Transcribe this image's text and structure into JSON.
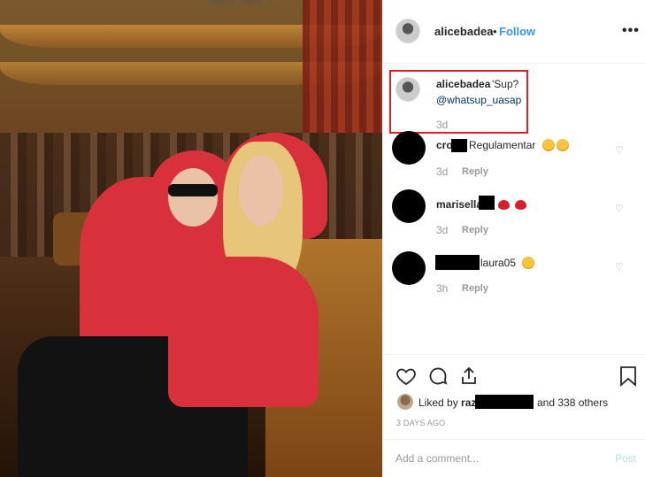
{
  "browser": {
    "url_fragment": "https://...com/.../"
  },
  "header": {
    "username": "alicebadea",
    "separator": "•",
    "follow_label": "Follow",
    "more_label": "•••",
    "avatar_icon": "profile-avatar-icon"
  },
  "caption": {
    "username": "alicebadea",
    "text": "'Sup?",
    "mention": "@whatsup_uasap",
    "time": "3d"
  },
  "comments": [
    {
      "username": "cro",
      "text": "Regulamentar",
      "time": "3d",
      "reply": "Reply",
      "emojis": [
        "sunglasses-emoji",
        "sunglasses-emoji"
      ]
    },
    {
      "username": "marisella",
      "text": "",
      "time": "3d",
      "reply": "Reply",
      "emojis": [
        "heart-emoji",
        "heart-emoji"
      ]
    },
    {
      "username": "laura05",
      "text": "",
      "time": "3h",
      "reply": "Reply",
      "emojis": [
        "grin-emoji"
      ]
    }
  ],
  "likes": {
    "prefix": "Liked by",
    "user_partial": "raz",
    "suffix": "and 338 others"
  },
  "date": "3 DAYS AGO",
  "comment_box": {
    "placeholder": "Add a comment...",
    "post_label": "Post"
  },
  "colors": {
    "follow": "#3897f0",
    "highlight_border": "#e0202a",
    "post_disabled": "#b3dbff"
  }
}
